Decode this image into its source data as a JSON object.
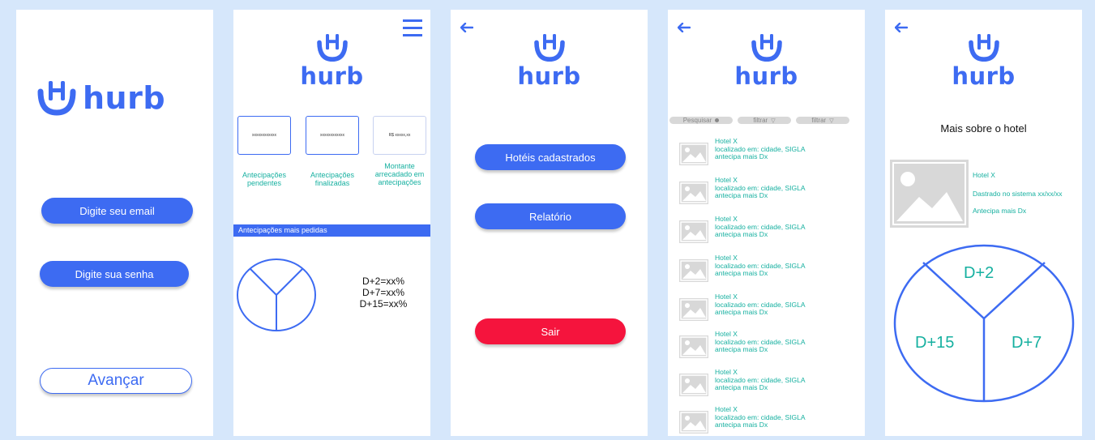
{
  "brand": {
    "name": "hurb",
    "color": "#3d6bf2",
    "accent_teal": "#16b0a0",
    "danger": "#f5143d"
  },
  "login": {
    "email_label": "Digite seu email",
    "password_label": "Digite sua senha",
    "next_label": "Avançar"
  },
  "dashboard": {
    "menu_icon": "hamburger-menu-icon",
    "cards": [
      {
        "value": "xxxxxxxxxxxx",
        "caption": "Antecipações pendentes"
      },
      {
        "value": "xxxxxxxxxxxx",
        "caption": "Antecipações finalizadas"
      },
      {
        "value": "R$ xxxxx,xx",
        "caption": "Montante arrecadado em antecipações"
      }
    ],
    "section_title": "Antecipações mais pedidas",
    "stats": [
      "D+2=xx%",
      "D+7=xx%",
      "D+15=xx%"
    ]
  },
  "menu": {
    "back_icon": "arrow-left-icon",
    "hotels_label": "Hotéis cadastrados",
    "report_label": "Relatório",
    "logout_label": "Sair"
  },
  "hotel_list": {
    "search_label": "Pesquisar",
    "filter1_label": "filtrar",
    "filter2_label": "filtrar",
    "items": [
      {
        "name": "Hotel X",
        "location": "localizado em: cidade, SIGLA",
        "advance": "antecipa mais Dx"
      },
      {
        "name": "Hotel X",
        "location": "localizado em: cidade, SIGLA",
        "advance": "antecipa mais Dx"
      },
      {
        "name": "Hotel X",
        "location": "localizado em: cidade, SIGLA",
        "advance": "antecipa mais Dx"
      },
      {
        "name": "Hotel X",
        "location": "localizado em: cidade, SIGLA",
        "advance": "antecipa mais Dx"
      },
      {
        "name": "Hotel X",
        "location": "localizado em: cidade, SIGLA",
        "advance": "antecipa mais Dx"
      },
      {
        "name": "Hotel X",
        "location": "localizado em: cidade, SIGLA",
        "advance": "antecipa mais Dx"
      },
      {
        "name": "Hotel X",
        "location": "localizado em: cidade, SIGLA",
        "advance": "antecipa mais Dx"
      },
      {
        "name": "Hotel X",
        "location": "localizado em: cidade, SIGLA",
        "advance": "antecipa mais Dx"
      }
    ]
  },
  "hotel_detail": {
    "title": "Mais sobre o hotel",
    "name": "Hotel X",
    "registered": "Dastrado no sistema xx/xx/xx",
    "advance": "Antecipa mais Dx",
    "pie_labels": [
      "D+2",
      "D+15",
      "D+7"
    ]
  }
}
